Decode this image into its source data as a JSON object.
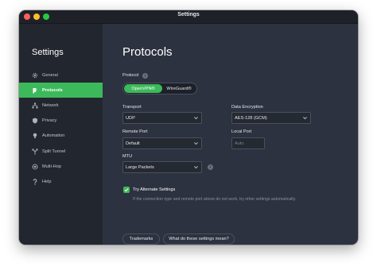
{
  "window": {
    "title": "Settings"
  },
  "sidebar": {
    "title": "Settings",
    "items": [
      {
        "label": "General",
        "icon": "gear-icon"
      },
      {
        "label": "Protocols",
        "icon": "protocols-icon",
        "active": true
      },
      {
        "label": "Network",
        "icon": "network-icon"
      },
      {
        "label": "Privacy",
        "icon": "shield-icon"
      },
      {
        "label": "Automation",
        "icon": "bulb-icon"
      },
      {
        "label": "Split Tunnel",
        "icon": "split-icon"
      },
      {
        "label": "Multi-Hop",
        "icon": "multihop-icon"
      },
      {
        "label": "Help",
        "icon": "question-icon"
      }
    ]
  },
  "main": {
    "title": "Protocols",
    "protocol": {
      "label": "Protocol",
      "options": [
        "OpenVPN®",
        "WireGuard®"
      ],
      "selected": "OpenVPN®"
    },
    "transport": {
      "label": "Transport",
      "value": "UDP"
    },
    "encryption": {
      "label": "Data Encryption",
      "value": "AES-128 (GCM)"
    },
    "remote_port": {
      "label": "Remote Port",
      "value": "Default"
    },
    "local_port": {
      "label": "Local Port",
      "placeholder": "Auto"
    },
    "mtu": {
      "label": "MTU",
      "value": "Large Packets"
    },
    "alternate": {
      "label": "Try Alternate Settings",
      "checked": true,
      "hint": "If the connection type and remote port above do not work, try other settings automatically."
    },
    "buttons": {
      "trademarks": "Trademarks",
      "help": "What do these settings mean?"
    }
  },
  "colors": {
    "accent": "#3cb95a",
    "background": "#2d3240",
    "sidebar": "#22262f"
  }
}
